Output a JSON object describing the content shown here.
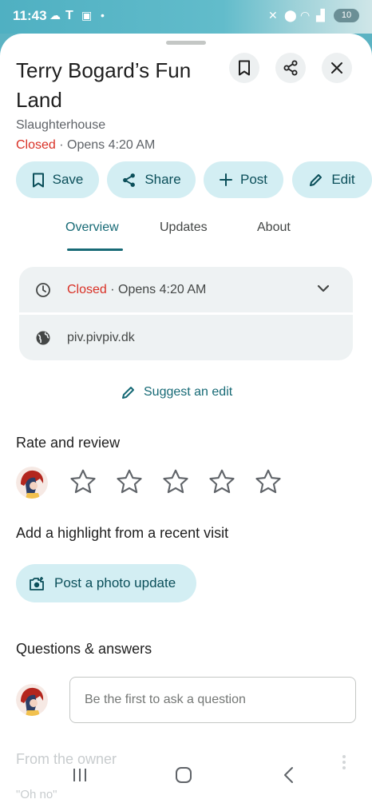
{
  "status": {
    "time": "11:43",
    "battery": "10"
  },
  "place": {
    "title": "Terry Bogard’s Fun Land",
    "category": "Slaughterhouse",
    "status": "Closed",
    "opens": " · Opens 4:20 AM"
  },
  "actions": [
    {
      "label": "Save",
      "icon": "bookmark-icon"
    },
    {
      "label": "Share",
      "icon": "share-icon"
    },
    {
      "label": "Post",
      "icon": "plus-icon"
    },
    {
      "label": "Edit",
      "icon": "pencil-icon"
    }
  ],
  "tabs": [
    {
      "label": "Overview",
      "active": true
    },
    {
      "label": "Updates",
      "active": false
    },
    {
      "label": "About",
      "active": false
    }
  ],
  "info": {
    "status": "Closed",
    "opens": " · Opens 4:20 AM",
    "website": "piv.pivpiv.dk"
  },
  "suggest_edit": "Suggest an edit",
  "rate": {
    "heading": "Rate and review",
    "stars_total": 5,
    "stars_selected": 0
  },
  "highlight": {
    "heading": "Add a highlight from a recent visit",
    "button": "Post a photo update"
  },
  "qa": {
    "heading": "Questions & answers",
    "placeholder": "Be the first to ask a question"
  },
  "owner": {
    "heading": "From the owner",
    "quote": "\"Oh no\""
  },
  "colors": {
    "accent": "#176a76",
    "chip_bg": "#d3eef3",
    "closed": "#d93025"
  }
}
